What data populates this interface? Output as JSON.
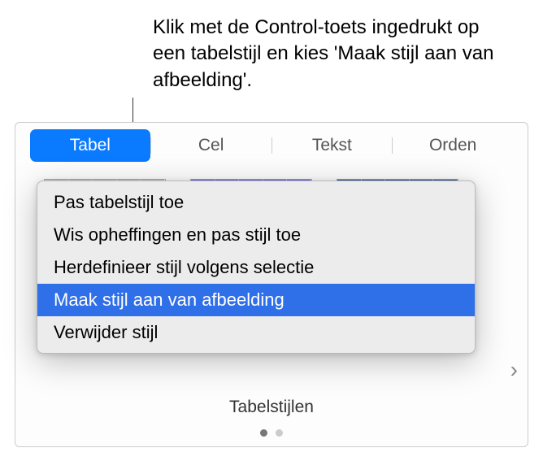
{
  "callout": {
    "text": "Klik met de Control-toets ingedrukt op een tabelstijl en kies 'Maak stijl aan van afbeelding'."
  },
  "tabs": {
    "items": [
      {
        "label": "Tabel",
        "active": true
      },
      {
        "label": "Cel",
        "active": false
      },
      {
        "label": "Tekst",
        "active": false
      },
      {
        "label": "Orden",
        "active": false
      }
    ]
  },
  "context_menu": {
    "items": [
      {
        "label": "Pas tabelstijl toe"
      },
      {
        "label": "Wis opheffingen en pas stijl toe"
      },
      {
        "label": "Herdefinieer stijl volgens selectie"
      },
      {
        "label": "Maak stijl aan van afbeelding",
        "highlighted": true
      },
      {
        "label": "Verwijder stijl"
      }
    ]
  },
  "section_label": "Tabelstijlen",
  "chevron": "›"
}
